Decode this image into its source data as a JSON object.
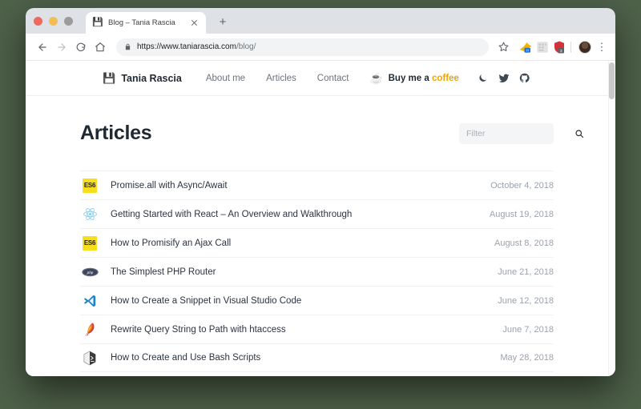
{
  "browser": {
    "tab": {
      "favicon": "floppy-disk-icon",
      "title": "Blog – Tania Rascia",
      "close_label": "×"
    },
    "new_tab_label": "+",
    "toolbar": {
      "back_label": "back-icon",
      "forward_label": "forward-icon",
      "reload_label": "reload-icon",
      "home_label": "home-icon",
      "lock_label": "lock-icon",
      "url_secure": "https://www.taniarascia.com",
      "url_path": "/blog/",
      "star_label": "star-icon",
      "menu_label": "⋮",
      "extensions": [
        {
          "name": "honey-extension",
          "color": "#f5a623"
        },
        {
          "name": "grammar-extension",
          "color": "#d8d8d8"
        },
        {
          "name": "adblock-extension",
          "color": "#d0343a"
        }
      ]
    }
  },
  "site": {
    "logo": {
      "icon": "floppy-disk-icon",
      "text": "Tania Rascia"
    },
    "nav": [
      {
        "label": "About me",
        "name": "nav-about-me"
      },
      {
        "label": "Articles",
        "name": "nav-articles"
      },
      {
        "label": "Contact",
        "name": "nav-contact"
      }
    ],
    "buy_coffee": {
      "icon": "coffee-cup-icon",
      "text_main": "Buy me a ",
      "text_accent": "coffee",
      "accent_color": "#f0a500"
    },
    "social": [
      {
        "name": "dark-mode-moon-icon"
      },
      {
        "name": "twitter-icon"
      },
      {
        "name": "github-icon"
      }
    ]
  },
  "main": {
    "title": "Articles",
    "filter": {
      "value": "",
      "placeholder": "Filter",
      "search_icon": "search-icon"
    },
    "articles": [
      {
        "icon": "es6",
        "icon_label": "ES6",
        "title": "Promise.all with Async/Await",
        "date": "October 4, 2018"
      },
      {
        "icon": "react",
        "icon_label": "React",
        "title": "Getting Started with React – An Overview and Walkthrough",
        "date": "August 19, 2018"
      },
      {
        "icon": "es6",
        "icon_label": "ES6",
        "title": "How to Promisify an Ajax Call",
        "date": "August 8, 2018"
      },
      {
        "icon": "php",
        "icon_label": "PHP",
        "title": "The Simplest PHP Router",
        "date": "June 21, 2018"
      },
      {
        "icon": "vscode",
        "icon_label": "Visual Studio Code",
        "title": "How to Create a Snippet in Visual Studio Code",
        "date": "June 12, 2018"
      },
      {
        "icon": "apache",
        "icon_label": "Apache",
        "title": "Rewrite Query String to Path with htaccess",
        "date": "June 7, 2018"
      },
      {
        "icon": "bash",
        "icon_label": "Bash",
        "title": "How to Create and Use Bash Scripts",
        "date": "May 28, 2018"
      }
    ]
  }
}
